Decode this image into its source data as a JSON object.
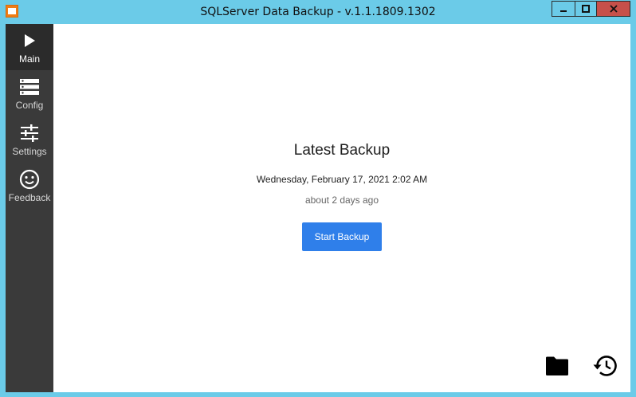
{
  "window": {
    "title": "SQLServer Data Backup - v.1.1.1809.1302",
    "controls": {
      "minimize_icon": "minimize-icon",
      "maximize_icon": "maximize-icon",
      "close_icon": "close-icon"
    },
    "colors": {
      "frame": "#6bcbe8",
      "close": "#c7504a"
    }
  },
  "sidebar": {
    "background": "#3a3a3a",
    "items": [
      {
        "label": "Main",
        "icon": "play-icon",
        "active": true
      },
      {
        "label": "Config",
        "icon": "server-icon",
        "active": false
      },
      {
        "label": "Settings",
        "icon": "sliders-icon",
        "active": false
      },
      {
        "label": "Feedback",
        "icon": "smiley-icon",
        "active": false
      }
    ]
  },
  "main": {
    "heading": "Latest Backup",
    "backup_date": "Wednesday, February 17, 2021 2:02 AM",
    "relative_time": "about 2 days ago",
    "start_button_label": "Start Backup",
    "accent": "#2f7fea",
    "tools": [
      {
        "icon": "folder-icon"
      },
      {
        "icon": "history-icon"
      }
    ]
  }
}
